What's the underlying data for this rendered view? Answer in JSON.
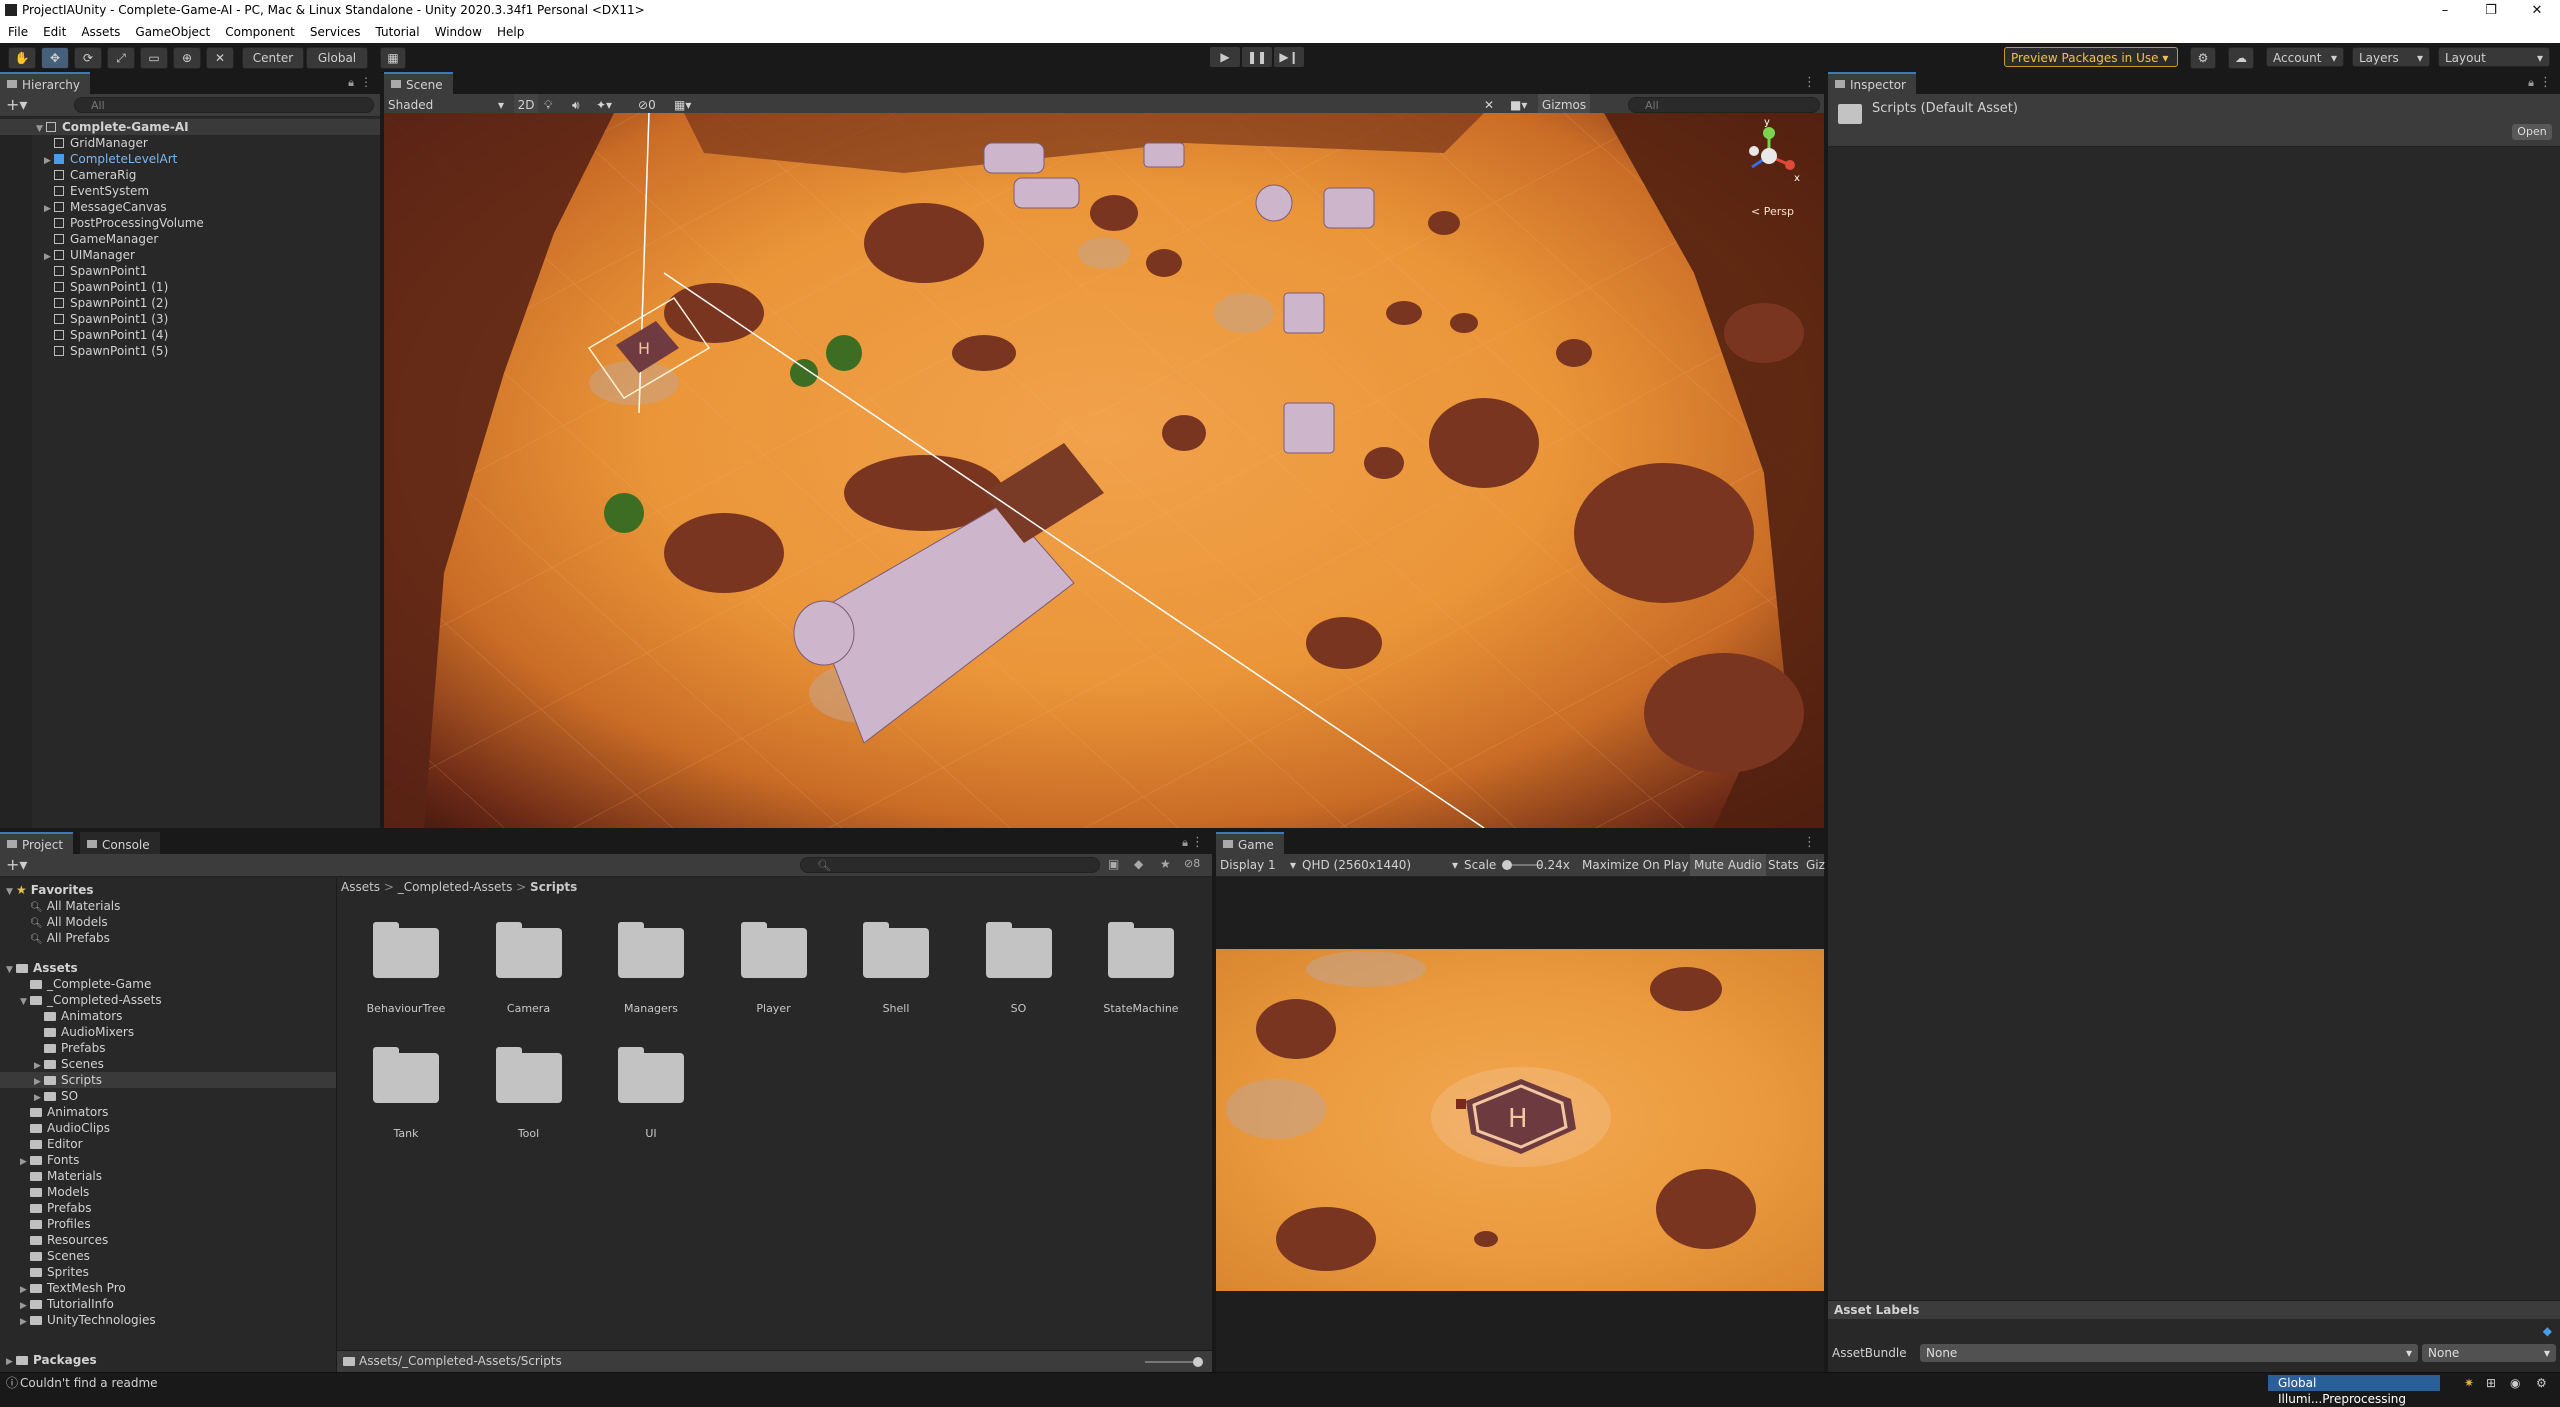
{
  "window": {
    "title": "ProjectIAUnity - Complete-Game-AI - PC, Mac & Linux Standalone - Unity 2020.3.34f1 Personal <DX11>",
    "controls": [
      "–",
      "❐",
      "✕"
    ]
  },
  "menu": [
    "File",
    "Edit",
    "Assets",
    "GameObject",
    "Component",
    "Services",
    "Tutorial",
    "Window",
    "Help"
  ],
  "toolbar": {
    "pivot": "Center",
    "space": "Global",
    "preview_packages": "Preview Packages in Use",
    "account": "Account",
    "layers": "Layers",
    "layout": "Layout"
  },
  "hierarchy": {
    "tab": "Hierarchy",
    "search_placeholder": "All",
    "scene": "Complete-Game-AI",
    "items": [
      {
        "label": "GridManager",
        "prefab": false
      },
      {
        "label": "CompleteLevelArt",
        "prefab": true
      },
      {
        "label": "CameraRig",
        "prefab": false
      },
      {
        "label": "EventSystem",
        "prefab": false
      },
      {
        "label": "MessageCanvas",
        "prefab": false
      },
      {
        "label": "PostProcessingVolume",
        "prefab": false
      },
      {
        "label": "GameManager",
        "prefab": false
      },
      {
        "label": "UIManager",
        "prefab": false
      },
      {
        "label": "SpawnPoint1",
        "prefab": false
      },
      {
        "label": "SpawnPoint1 (1)",
        "prefab": false
      },
      {
        "label": "SpawnPoint1 (2)",
        "prefab": false
      },
      {
        "label": "SpawnPoint1 (3)",
        "prefab": false
      },
      {
        "label": "SpawnPoint1 (4)",
        "prefab": false
      },
      {
        "label": "SpawnPoint1 (5)",
        "prefab": false
      }
    ]
  },
  "scene": {
    "tab": "Scene",
    "shading": "Shaded",
    "mode_2d": "2D",
    "hidden_count": "0",
    "gizmos": "Gizmos",
    "search_placeholder": "All",
    "persp": "< Persp",
    "axis_y": "y",
    "axis_x": "x"
  },
  "inspector": {
    "tab": "Inspector",
    "asset_title": "Scripts (Default Asset)",
    "open_button": "Open",
    "asset_labels": "Asset Labels",
    "asset_bundle_label": "AssetBundle",
    "asset_bundle_value": "None",
    "asset_bundle_variant": "None"
  },
  "project": {
    "tabs": [
      "Project",
      "Console"
    ],
    "hidden_count": "8",
    "favorites_label": "Favorites",
    "favorites": [
      "All Materials",
      "All Models",
      "All Prefabs"
    ],
    "assets_label": "Assets",
    "assets_tree": [
      {
        "label": "_Complete-Game",
        "depth": 1,
        "arrow": ""
      },
      {
        "label": "_Completed-Assets",
        "depth": 1,
        "arrow": "▼"
      },
      {
        "label": "Animators",
        "depth": 2,
        "arrow": ""
      },
      {
        "label": "AudioMixers",
        "depth": 2,
        "arrow": ""
      },
      {
        "label": "Prefabs",
        "depth": 2,
        "arrow": ""
      },
      {
        "label": "Scenes",
        "depth": 2,
        "arrow": "▶"
      },
      {
        "label": "Scripts",
        "depth": 2,
        "arrow": "▶"
      },
      {
        "label": "SO",
        "depth": 2,
        "arrow": "▶"
      },
      {
        "label": "Animators",
        "depth": 1,
        "arrow": ""
      },
      {
        "label": "AudioClips",
        "depth": 1,
        "arrow": ""
      },
      {
        "label": "Editor",
        "depth": 1,
        "arrow": ""
      },
      {
        "label": "Fonts",
        "depth": 1,
        "arrow": "▶"
      },
      {
        "label": "Materials",
        "depth": 1,
        "arrow": ""
      },
      {
        "label": "Models",
        "depth": 1,
        "arrow": ""
      },
      {
        "label": "Prefabs",
        "depth": 1,
        "arrow": ""
      },
      {
        "label": "Profiles",
        "depth": 1,
        "arrow": ""
      },
      {
        "label": "Resources",
        "depth": 1,
        "arrow": ""
      },
      {
        "label": "Scenes",
        "depth": 1,
        "arrow": ""
      },
      {
        "label": "Sprites",
        "depth": 1,
        "arrow": ""
      },
      {
        "label": "TextMesh Pro",
        "depth": 1,
        "arrow": "▶"
      },
      {
        "label": "TutorialInfo",
        "depth": 1,
        "arrow": "▶"
      },
      {
        "label": "UnityTechnologies",
        "depth": 1,
        "arrow": "▶"
      }
    ],
    "packages_label": "Packages",
    "breadcrumb": [
      "Assets",
      "_Completed-Assets",
      "Scripts"
    ],
    "folders": [
      "BehaviourTree",
      "Camera",
      "Managers",
      "Player",
      "Shell",
      "SO",
      "StateMachine",
      "Tank",
      "Tool",
      "UI"
    ],
    "footer_path": "Assets/_Completed-Assets/Scripts"
  },
  "game": {
    "tab": "Game",
    "display": "Display 1",
    "resolution": "QHD (2560x1440)",
    "scale_label": "Scale",
    "scale_value": "0.24x",
    "maximize": "Maximize On Play",
    "mute": "Mute Audio",
    "stats": "Stats",
    "gizmos": "Giz"
  },
  "status": {
    "message": "Couldn't find a readme",
    "progress": "Global Illumi...Preprocessing"
  }
}
